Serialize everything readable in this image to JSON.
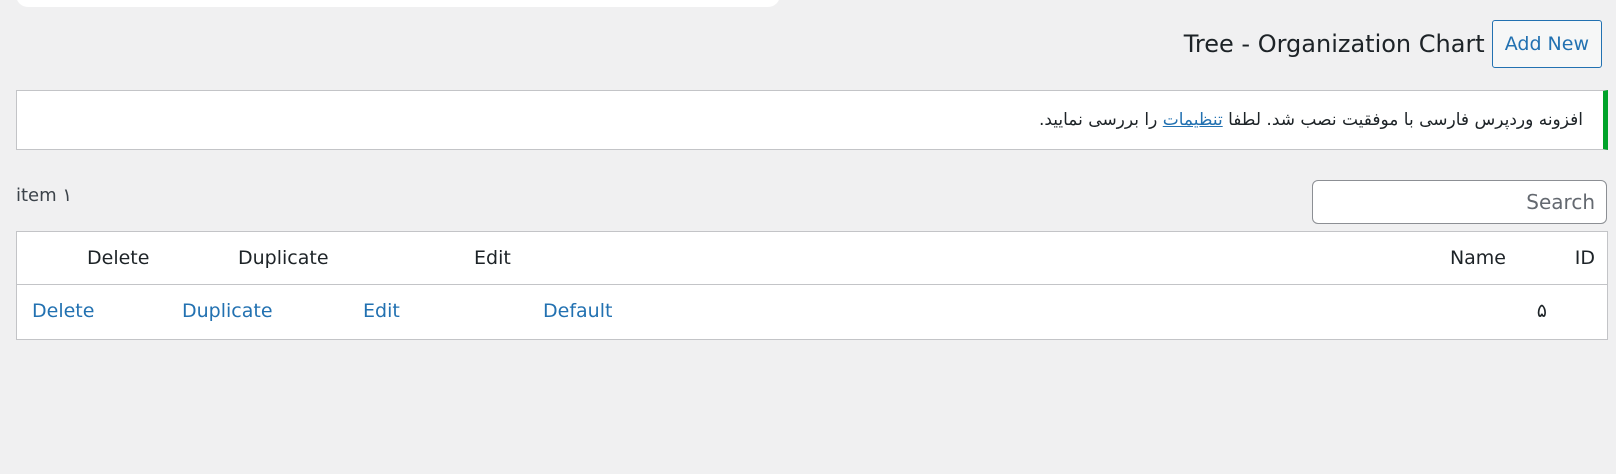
{
  "header": {
    "title": "Tree - Organization Chart",
    "add_new_label": "Add New"
  },
  "notice": {
    "text_before": "افزونه وردپرس فارسی با موفقیت نصب شد. لطفا ",
    "link_label": "تنظیمات",
    "text_after": " را بررسی نمایید.",
    "accent_color": "#00a32a"
  },
  "list": {
    "item_count": "item ۱",
    "search_placeholder": "Search"
  },
  "table": {
    "columns": {
      "delete": "Delete",
      "duplicate": "Duplicate",
      "edit": "Edit",
      "name": "Name",
      "id": "ID"
    },
    "rows": [
      {
        "delete": "Delete",
        "duplicate": "Duplicate",
        "edit": "Edit",
        "name": "Default",
        "id": "۵"
      }
    ]
  },
  "colors": {
    "link": "#2271b1",
    "background": "#f0f0f1"
  }
}
